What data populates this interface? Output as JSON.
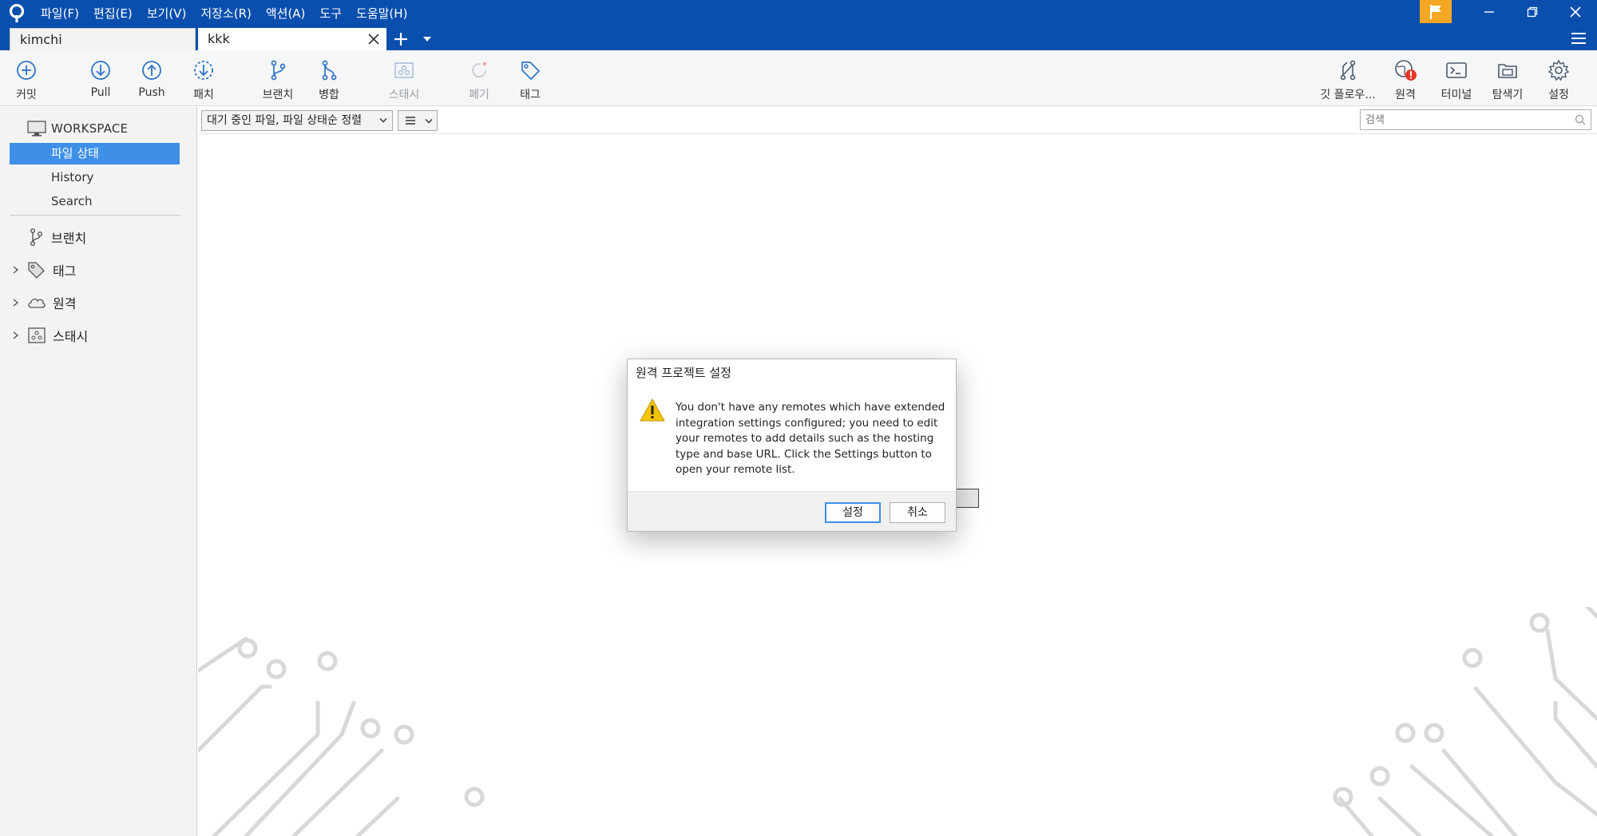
{
  "menu": [
    "파일(F)",
    "편집(E)",
    "보기(V)",
    "저장소(R)",
    "액션(A)",
    "도구",
    "도움말(H)"
  ],
  "tabs": {
    "repo_left": "kimchi",
    "repo_active": "kkk"
  },
  "toolbar": {
    "commit": "커밋",
    "pull": "Pull",
    "push": "Push",
    "fetch": "패치",
    "branch": "브랜치",
    "merge": "병합",
    "stash": "스태시",
    "discard": "폐기",
    "tag": "태그",
    "git_flow": "깃 플로우...",
    "remote": "원격",
    "terminal": "터미널",
    "explorer": "탐색기",
    "settings": "설정"
  },
  "sidebar": {
    "workspace": "WORKSPACE",
    "items": [
      "파일 상태",
      "History",
      "Search"
    ],
    "groups": [
      "브랜치",
      "태그",
      "원격",
      "스태시"
    ]
  },
  "filter": {
    "sort_label": "대기 중인 파일, 파일 상태순 정렬",
    "search_placeholder": "검색"
  },
  "dialog": {
    "title": "원격 프로젝트 설정",
    "message": "You don't have any remotes which have extended integration settings configured; you need to edit your remotes to add details such as the hosting type and base URL. Click the Settings button to open your remote list.",
    "ok": "설정",
    "cancel": "취소"
  },
  "colors": {
    "titlebar": "#0a4fae",
    "accent": "#3d8fe8",
    "flag": "#f5a623",
    "warning": "#f4c400"
  }
}
